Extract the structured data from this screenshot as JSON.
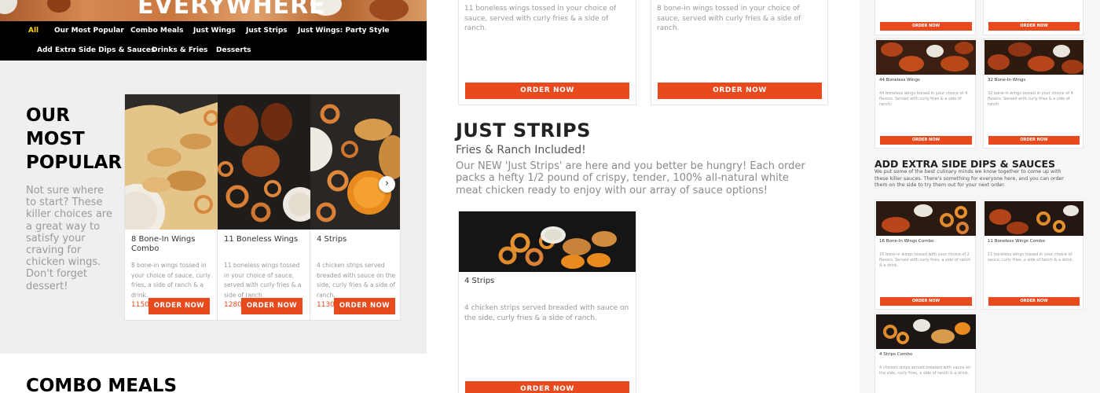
{
  "hero": {
    "title": "EVERYWHERE"
  },
  "nav": {
    "items": [
      {
        "label": "All",
        "active": true
      },
      {
        "label": "Our Most Popular"
      },
      {
        "label": "Combo Meals"
      },
      {
        "label": "Just Wings"
      },
      {
        "label": "Just Strips"
      },
      {
        "label": "Just Wings: Party Style"
      },
      {
        "label": "Add Extra Side Dips & Sauces"
      },
      {
        "label": "Drinks & Fries"
      },
      {
        "label": "Desserts"
      }
    ]
  },
  "most_popular": {
    "title": "OUR MOST POPULAR",
    "description": "Not sure where to start? These killer choices are a great way to satisfy your craving for chicken wings. Don't forget dessert!",
    "next_icon": "chevron-right-icon",
    "products": [
      {
        "name": "8 Bone-In Wings Combo",
        "description": "8 bone-in wings tossed in your choice of sauce, curly fries, a side of ranch & a drink.",
        "calories": "1150",
        "button": "ORDER NOW"
      },
      {
        "name": "11 Boneless Wings",
        "description": "11 boneless wings tossed in your choice of sauce, served with curly fries & a side of ranch.",
        "calories": "1280",
        "button": "ORDER NOW"
      },
      {
        "name": "4 Strips",
        "description": "4 chicken strips served breaded with sauce on the side, curly fries & a side of ranch.",
        "calories": "1130",
        "button": "ORDER NOW"
      }
    ]
  },
  "combo": {
    "title": "COMBO MEALS"
  },
  "middle": {
    "top_cards": [
      {
        "description": "11 boneless wings tossed in your choice of sauce, served with curly fries & a side of ranch.",
        "button": "ORDER NOW"
      },
      {
        "description": "8 bone-in wings tossed in your choice of sauce, served with curly fries & a side of ranch.",
        "button": "ORDER NOW"
      }
    ],
    "just_strips": {
      "title": "JUST STRIPS",
      "subtitle": "Fries & Ranch Included!",
      "description": "Our NEW 'Just Strips' are here and you better be hungry! Each order packs a hefty 1/2 pound of crispy, tender, 100% all-natural white meat chicken ready to enjoy with our array of sauce options!",
      "card": {
        "name": "4 Strips",
        "description": "4 chicken strips served breaded with sauce on the side, curly fries & a side of ranch.",
        "button": "ORDER NOW"
      }
    }
  },
  "right": {
    "top_buttons": [
      "ORDER NOW",
      "ORDER NOW"
    ],
    "wing_cards": [
      {
        "name": "44 Boneless Wings",
        "description": "44 boneless wings tossed in your choice of 4 flavors. Served with curly fries & a side of ranch.",
        "button": "ORDER NOW"
      },
      {
        "name": "32 Bone-In Wings",
        "description": "32 bone-in wings tossed in your choice of 4 flavors. Served with curly fries & a side of ranch.",
        "button": "ORDER NOW"
      }
    ],
    "add_extra": {
      "title": "ADD EXTRA SIDE DIPS & SAUCES",
      "description": "We put some of the best culinary minds we know together to come up with these killer sauces. There's something for everyone here, and you can order them on the side to try them out for your next order."
    },
    "combo_cards": [
      {
        "name": "16 Bone-In Wings Combo",
        "description": "16 bone-in wings tossed with your choice of 2 flavors. Served with curly fries, a side of ranch & a drink.",
        "button": "ORDER NOW"
      },
      {
        "name": "11 Boneless Wings Combo",
        "description": "11 boneless wings tossed in your choice of sauce, curly fries, a side of ranch & a drink.",
        "button": "ORDER NOW"
      },
      {
        "name": "4 Strips Combo",
        "description": "4 chicken strips served breaded with sauce on the side, curly fries, a side of ranch & a drink."
      }
    ]
  },
  "colors": {
    "accent": "#e8491d",
    "nav_bg": "#000000",
    "nav_active": "#ffd400"
  }
}
